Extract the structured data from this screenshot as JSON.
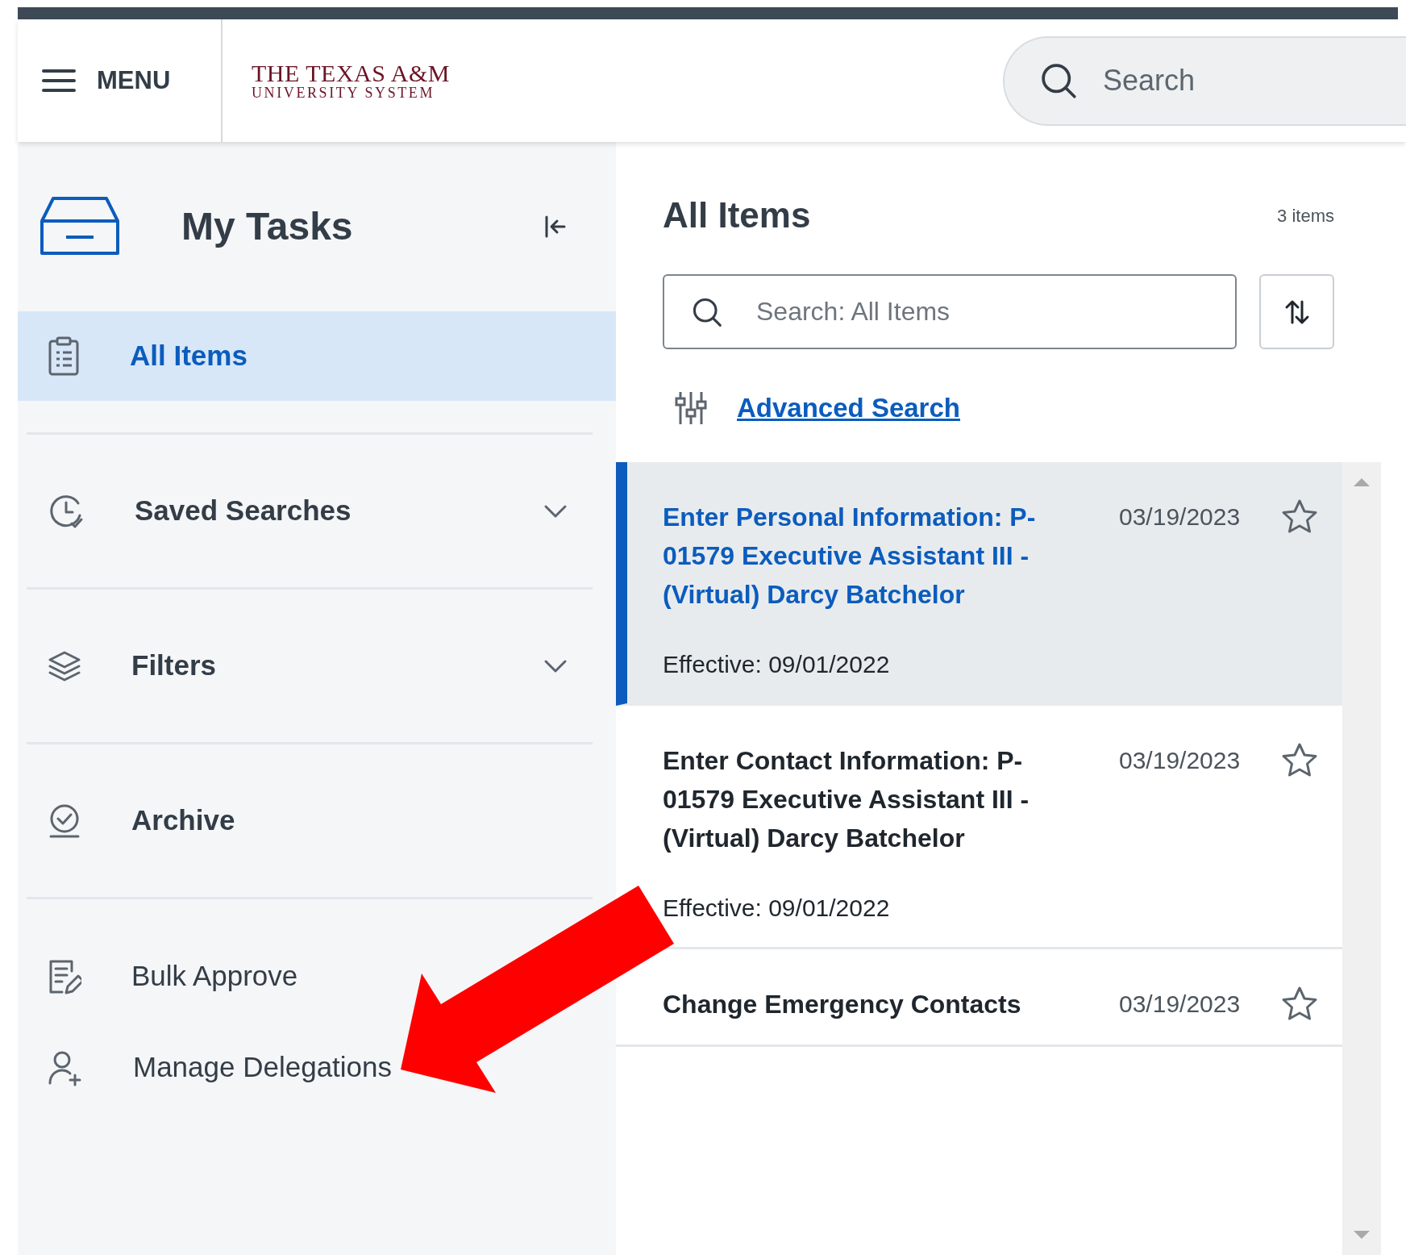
{
  "header": {
    "menu_label": "MENU",
    "logo": [
      "THE TEXAS A&M",
      "UNIVERSITY SYSTEM"
    ],
    "search": {
      "placeholder": "Search"
    }
  },
  "sidebar": {
    "title": "My Tasks",
    "items": [
      {
        "kind": "nav",
        "label": "All Items",
        "selected": true
      },
      {
        "kind": "expandable",
        "label": "Saved Searches",
        "selected": false,
        "expanded": false
      },
      {
        "kind": "expandable",
        "label": "Filters",
        "selected": false,
        "expanded": false
      },
      {
        "kind": "nav",
        "label": "Archive",
        "selected": false
      },
      {
        "kind": "action",
        "label": "Bulk Approve"
      },
      {
        "kind": "action",
        "label": "Manage Delegations"
      }
    ]
  },
  "panel": {
    "title": "All Items",
    "count": "3 items",
    "search": {
      "placeholder": "Search: All Items"
    },
    "advanced_search": "Advanced Search",
    "tasks": [
      {
        "title": "Enter Personal Information: P-01579 Executive Assistant III - (Virtual) Darcy Batchelor",
        "date": "03/19/2023",
        "effective": "Effective: 09/01/2022",
        "selected": true,
        "starred": false
      },
      {
        "title": "Enter Contact Information: P-01579 Executive Assistant III - (Virtual) Darcy Batchelor",
        "date": "03/19/2023",
        "effective": "Effective: 09/01/2022",
        "selected": false,
        "starred": false
      },
      {
        "title": "Change Emergency Contacts",
        "date": "03/19/2023",
        "selected": false,
        "starred": false
      }
    ]
  },
  "annotations": [
    {
      "kind": "arrow"
    }
  ]
}
